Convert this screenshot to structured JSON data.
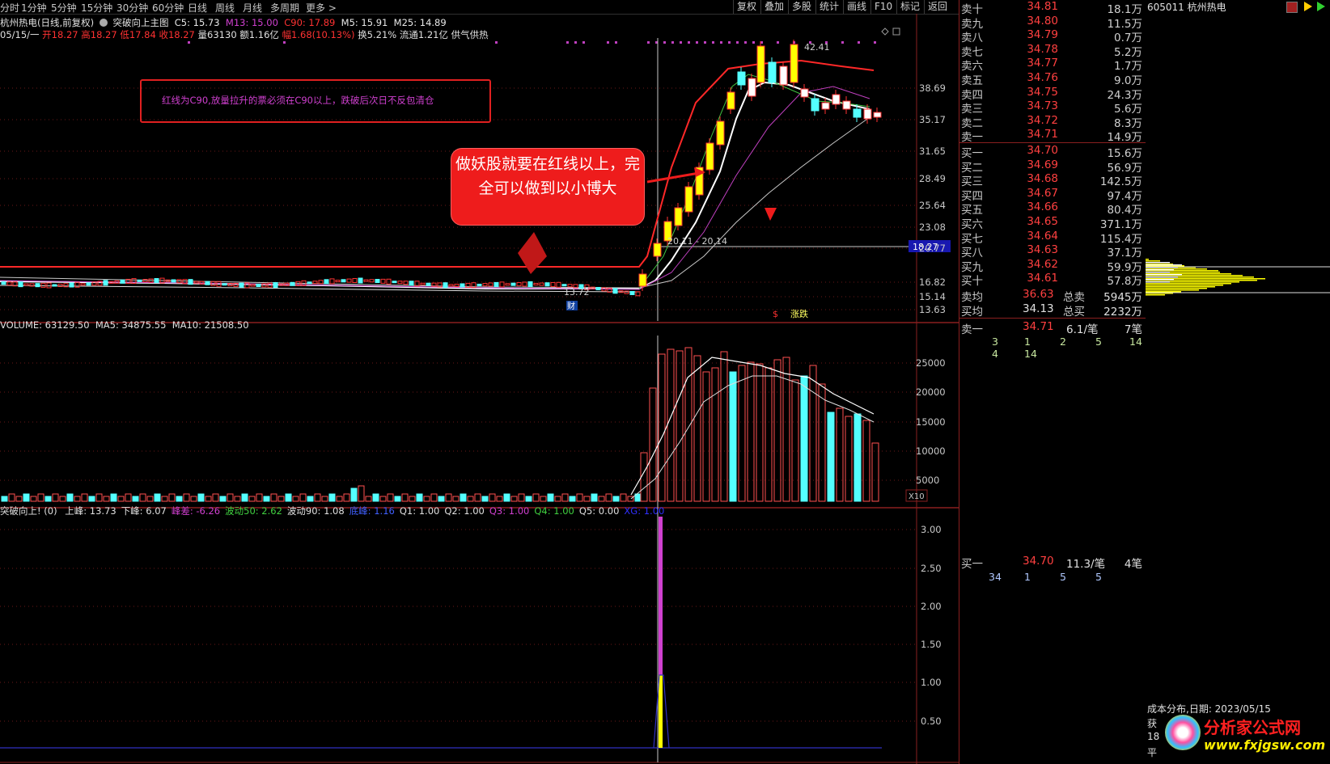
{
  "toolbar": {
    "periods": [
      "分时",
      "1分钟",
      "5分钟",
      "15分钟",
      "30分钟",
      "60分钟",
      "日线",
      "周线",
      "月线",
      "多周期",
      "更多 >"
    ],
    "right_buttons": [
      "复权",
      "叠加",
      "多股",
      "统计",
      "画线",
      "F10",
      "标记",
      "返回"
    ]
  },
  "main_chart": {
    "title": "杭州热电(日线,前复权)",
    "indicator_name": "突破向上主图",
    "c5": "C5: 15.73",
    "m13": "M13: 15.00",
    "c90": "C90: 17.89",
    "m5": "M5: 15.91",
    "m25": "M25: 14.89",
    "ohlc_date": "05/15/一",
    "open": "开18.27",
    "high": "高18.27",
    "low": "低17.84",
    "close": "收18.27",
    "volume": "量63130",
    "amount": "额1.16亿",
    "change": "幅1.68(10.13%)",
    "turnover": "换5.21%",
    "float_cap": "流通1.21亿",
    "supply": "供气供热",
    "annotation_box": "红线为C90,放量拉升的票必须在C90以上，跌破后次日不反包清仓",
    "bubble_text": "做妖股就要在红线以上，完全可以做到以小博大",
    "high_label": "42.41",
    "low_label": "13.72",
    "price_box": "20.11 - 20.14",
    "current_price_tag": "18.27",
    "fin_mark": "财",
    "bottom_marks": [
      "$",
      "涨跌"
    ],
    "y_ticks": [
      "38.69",
      "35.17",
      "31.65",
      "28.49",
      "25.64",
      "23.08",
      "20.77",
      "16.82",
      "15.14",
      "13.63"
    ]
  },
  "volume_chart": {
    "legend_vol": "VOLUME: 63129.50",
    "legend_ma5": "MA5: 34875.55",
    "legend_ma10": "MA10: 21508.50",
    "y_ticks": [
      "25000",
      "20000",
      "15000",
      "10000",
      "5000"
    ],
    "unit": "X10"
  },
  "indicator_chart": {
    "name": "突破向上!",
    "param": "(0)",
    "items": [
      {
        "label": "上峰: 13.73",
        "color": "#e0e0e0"
      },
      {
        "label": "下峰: 6.07",
        "color": "#e0e0e0"
      },
      {
        "label": "峰差: -6.26",
        "color": "#d040d0"
      },
      {
        "label": "波动50: 2.62",
        "color": "#40d040"
      },
      {
        "label": "波动90: 1.08",
        "color": "#e0e0e0"
      },
      {
        "label": "底峰: 1.16",
        "color": "#4060ff"
      },
      {
        "label": "Q1: 1.00",
        "color": "#e0e0e0"
      },
      {
        "label": "Q2: 1.00",
        "color": "#e0e0e0"
      },
      {
        "label": "Q3: 1.00",
        "color": "#d040d0"
      },
      {
        "label": "Q4: 1.00",
        "color": "#40d040"
      },
      {
        "label": "Q5: 0.00",
        "color": "#e0e0e0"
      },
      {
        "label": "XG: 1.00",
        "color": "#3030ff"
      }
    ],
    "y_ticks": [
      "3.00",
      "2.50",
      "2.00",
      "1.50",
      "1.00",
      "0.50"
    ]
  },
  "orderbook": {
    "sells": [
      {
        "label": "卖十",
        "price": "34.81",
        "vol": "18.1万"
      },
      {
        "label": "卖九",
        "price": "34.80",
        "vol": "11.5万"
      },
      {
        "label": "卖八",
        "price": "34.79",
        "vol": "0.7万"
      },
      {
        "label": "卖七",
        "price": "34.78",
        "vol": "5.2万"
      },
      {
        "label": "卖六",
        "price": "34.77",
        "vol": "1.7万"
      },
      {
        "label": "卖五",
        "price": "34.76",
        "vol": "9.0万"
      },
      {
        "label": "卖四",
        "price": "34.75",
        "vol": "24.3万"
      },
      {
        "label": "卖三",
        "price": "34.73",
        "vol": "5.6万"
      },
      {
        "label": "卖二",
        "price": "34.72",
        "vol": "8.3万"
      },
      {
        "label": "卖一",
        "price": "34.71",
        "vol": "14.9万"
      }
    ],
    "buys": [
      {
        "label": "买一",
        "price": "34.70",
        "vol": "15.6万"
      },
      {
        "label": "买二",
        "price": "34.69",
        "vol": "56.9万"
      },
      {
        "label": "买三",
        "price": "34.68",
        "vol": "142.5万"
      },
      {
        "label": "买四",
        "price": "34.67",
        "vol": "97.4万"
      },
      {
        "label": "买五",
        "price": "34.66",
        "vol": "80.4万"
      },
      {
        "label": "买六",
        "price": "34.65",
        "vol": "371.1万"
      },
      {
        "label": "买七",
        "price": "34.64",
        "vol": "115.4万"
      },
      {
        "label": "买八",
        "price": "34.63",
        "vol": "37.1万"
      },
      {
        "label": "买九",
        "price": "34.62",
        "vol": "59.9万"
      },
      {
        "label": "买十",
        "price": "34.61",
        "vol": "57.8万"
      }
    ],
    "avg_sell_label": "卖均",
    "avg_sell": "36.63",
    "total_sell_label": "总卖",
    "total_sell": "5945万",
    "avg_buy_label": "买均",
    "avg_buy": "34.13",
    "total_buy_label": "总买",
    "total_buy": "2232万",
    "sell1_detail": {
      "label": "卖一",
      "price": "34.71",
      "per": "6.1/笔",
      "count": "7笔",
      "queue1": [
        "3",
        "1",
        "2",
        "5",
        "14"
      ],
      "queue2": [
        "4",
        "14"
      ]
    },
    "buy1_detail": {
      "label": "买一",
      "price": "34.70",
      "per": "11.3/笔",
      "count": "4笔",
      "queue1": [
        "34",
        "1",
        "5",
        "5"
      ]
    }
  },
  "chip": {
    "stock": "605011 杭州热电",
    "caption": "成本分布,日期: 2023/05/15",
    "side_labels": [
      "获",
      "18",
      "平"
    ],
    "logo_text": "分析家公式网",
    "logo_url": "www.fxjgsw.com"
  },
  "colors": {
    "up": "#ff3232",
    "down": "#54ffff",
    "yellow": "#ffff00",
    "magenta": "#d040d0",
    "grid": "#8a1f1f"
  }
}
